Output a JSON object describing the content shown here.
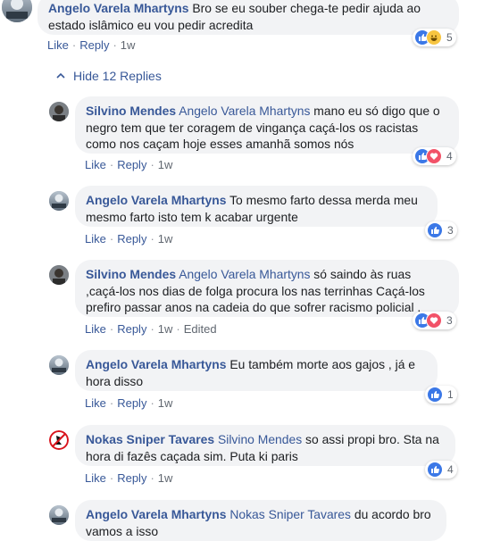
{
  "actions": {
    "like": "Like",
    "reply": "Reply",
    "separator": "·"
  },
  "hide_replies": "Hide 12 Replies",
  "colors": {
    "link": "#385898",
    "bubble": "#f2f3f5",
    "like": "#3b78e7",
    "love": "#f25268",
    "haha": "#f7c541"
  },
  "comments": [
    {
      "author": "Angelo Varela Mhartyns",
      "mention": "",
      "text_lines": [
        "Bro se eu souber chega-te pedir ajuda ao",
        "estado islâmico eu vou pedir acredita"
      ],
      "time": "1w",
      "edited": "",
      "reactions": [
        "like-icon",
        "haha-icon"
      ],
      "reaction_count": "5"
    },
    {
      "author": "Silvino Mendes",
      "mention": "Angelo Varela Mhartyns",
      "text_lines": [
        " mano eu só digo que o",
        "negro tem que ter coragem de vingança caçá-los os racistas",
        "como nos caçam hoje esses amanhã somos nós"
      ],
      "time": "1w",
      "edited": "",
      "reactions": [
        "like-icon",
        "love-icon"
      ],
      "reaction_count": "4"
    },
    {
      "author": "Angelo Varela Mhartyns",
      "mention": "",
      "text_lines": [
        "To mesmo farto dessa merda meu",
        "mesmo farto isto tem k acabar urgente"
      ],
      "time": "1w",
      "edited": "",
      "reactions": [
        "like-icon"
      ],
      "reaction_count": "3"
    },
    {
      "author": "Silvino Mendes",
      "mention": "Angelo Varela Mhartyns",
      "text_lines": [
        " só saindo às ruas",
        ",caçá-los nos dias de folga procura los nas terrinhas Caçá-los",
        "prefiro passar anos na cadeia do que sofrer racismo policial ."
      ],
      "time": "1w",
      "edited": "Edited",
      "reactions": [
        "like-icon",
        "love-icon"
      ],
      "reaction_count": "3"
    },
    {
      "author": "Angelo Varela Mhartyns",
      "mention": "",
      "text_lines": [
        "Eu também morte aos gajos , já e",
        "hora disso"
      ],
      "time": "1w",
      "edited": "",
      "reactions": [
        "like-icon"
      ],
      "reaction_count": "1"
    },
    {
      "author": "Nokas Sniper Tavares",
      "mention": "Silvino Mendes",
      "text_lines": [
        " so assi propi bro. Sta na",
        "hora di fazês caçada sim. Puta ki paris"
      ],
      "time": "1w",
      "edited": "",
      "reactions": [
        "like-icon"
      ],
      "reaction_count": "4"
    },
    {
      "author": "Angelo Varela Mhartyns",
      "mention": "Nokas Sniper Tavares",
      "text_lines": [
        " du acordo bro",
        "vamos a isso"
      ],
      "time": "",
      "edited": "",
      "reactions": [],
      "reaction_count": ""
    }
  ]
}
